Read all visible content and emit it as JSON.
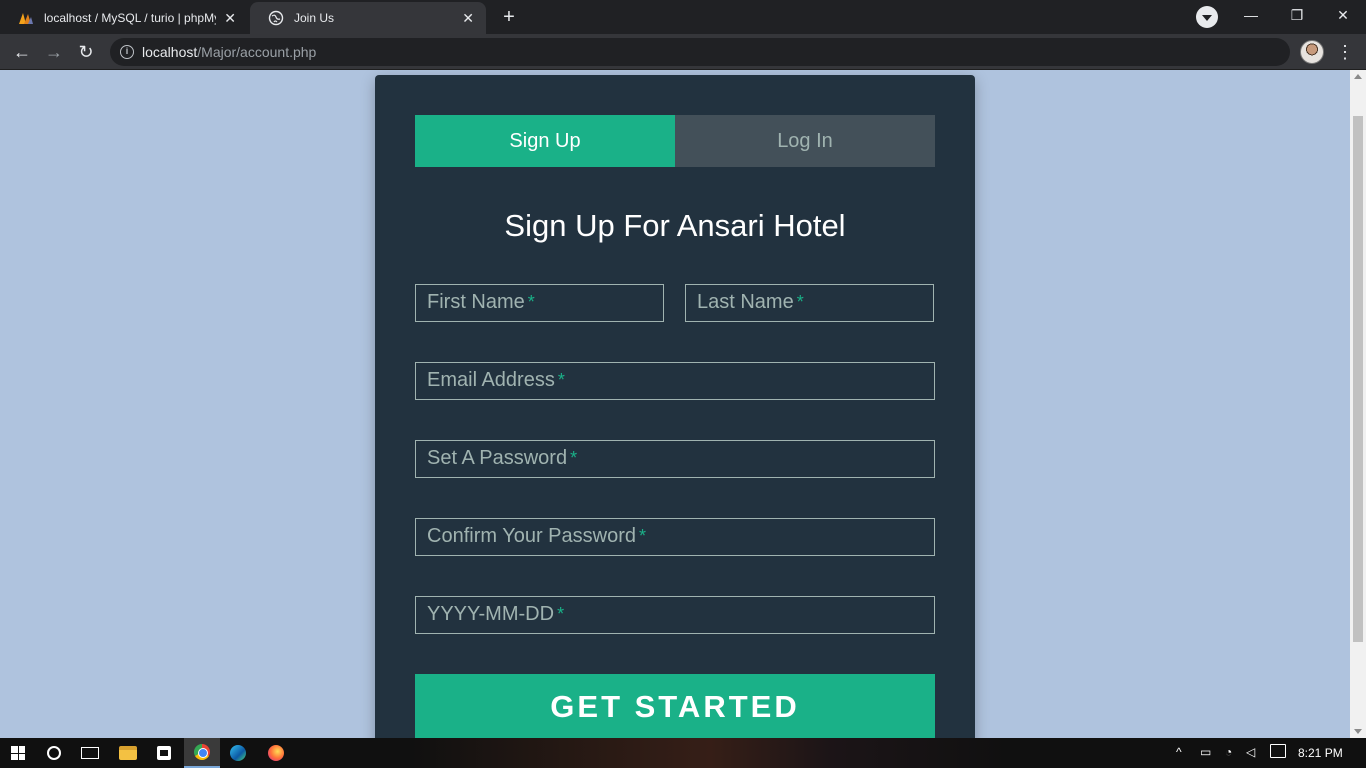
{
  "browser": {
    "tabs": [
      {
        "title": "localhost / MySQL / turio | phpMyAdmin",
        "favicon": "phpmyadmin-icon",
        "active": false
      },
      {
        "title": "Join Us",
        "favicon": "globe-icon",
        "active": true
      }
    ],
    "close_glyph": "✕",
    "new_tab_glyph": "+",
    "address": {
      "host": "localhost",
      "path": "/Major/account.php"
    },
    "window_controls": {
      "minimize": "—",
      "restore": "❐",
      "close": "✕"
    }
  },
  "form": {
    "tabs": {
      "signup": "Sign Up",
      "login": "Log In"
    },
    "heading": "Sign Up For Ansari Hotel",
    "required_mark": "*",
    "fields": {
      "first_name": "First Name",
      "last_name": "Last Name",
      "email": "Email Address",
      "password": "Set A Password",
      "confirm_password": "Confirm Your Password",
      "dob": "YYYY-MM-DD"
    },
    "submit": "GET STARTED"
  },
  "taskbar": {
    "time": "8:21 PM",
    "pinned": [
      "windows-start-icon",
      "cortana-icon",
      "task-view-icon",
      "file-explorer-icon",
      "store-icon",
      "chrome-icon",
      "edge-icon",
      "firefox-icon"
    ]
  },
  "colors": {
    "page_bg": "#afc3de",
    "card_bg": "#22323f",
    "accent": "#1ab188",
    "inactive_tab": "#435059",
    "placeholder": "#a0b3b0"
  }
}
